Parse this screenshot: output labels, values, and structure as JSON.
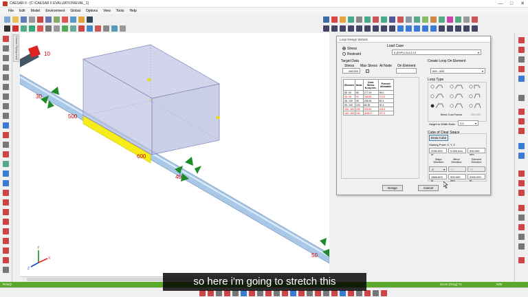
{
  "window": {
    "title": "CAESAR II - [C:\\CAESAR II EVALUATION\\EVAL_1]",
    "minimize": "—",
    "maximize": "□",
    "close": "✕"
  },
  "menu": [
    "File",
    "Edit",
    "Model",
    "Environment",
    "Global",
    "Options",
    "View",
    "Tools",
    "Help"
  ],
  "sidetab_label": "Classic Piping Input",
  "viewport": {
    "node_labels": {
      "n10": "10",
      "n30": "30",
      "n500": "500",
      "n600": "600",
      "n40": "40",
      "n50": "50"
    },
    "axis": {
      "x": "X",
      "y": "Y",
      "z": "Z"
    }
  },
  "dialog": {
    "title": "Loop Design Wizard",
    "mode_stress": "Stress",
    "mode_restraint": "Restraint",
    "load_case_label": "Load Case",
    "load_case_value": "5 (EXP) L5=L3-L4",
    "target_label": "Target Data",
    "col_stress": "Stress",
    "col_max_stress": "Max Stress",
    "col_at_node": "At Node",
    "col_on_element": "On Element",
    "stress_value": "200,000",
    "create_loop_label": "Create Loop On Element",
    "create_loop_value": "500 - 600",
    "loop_type_label": "Loop Type",
    "bend_cost_label": "Bend Cost Factor",
    "bend_cost_value": "200,000",
    "hw_ratio_label": "Height to Width Ratio",
    "hw_ratio_value": "2.0",
    "cube_label": "Cube of Clear Space",
    "draw_cube_button": "Draw Cube",
    "start_point_label": "Starting Point: X, Y, Z",
    "start_x": "2250.000 m",
    "start_y": "0.000 mm",
    "start_z": "900.000 mm",
    "major_dir_label": "Major Direction",
    "minor_dir_label": "Minor Direction",
    "element_dir_label": "Element Direction",
    "major_dir_value": "-Z",
    "minor_dir_value": "+Y",
    "element_dir_value": "+X",
    "major_size": "1866.603 m",
    "minor_size": "900.000 mm",
    "element_size": "2000.000 m",
    "design_button": "Design",
    "cancel_button": "Cancel",
    "table": {
      "headers": [
        "Element",
        "Node",
        "Code Stress N./sq.mm.",
        "Percent Allowable"
      ],
      "rows": [
        [
          "80-  90",
          "80",
          "277.00",
          "99.2"
        ],
        [
          "90-  95",
          "90",
          "755.85",
          "279.5"
        ],
        [
          "95- 100",
          "95",
          "228.96",
          "82.4"
        ],
        [
          "95- 100",
          "100",
          "84.35",
          "30.1"
        ],
        [
          "150- 160",
          "150",
          "299.65",
          "106.3"
        ],
        [
          "160- 180",
          "160",
          "(548.47",
          "207.5"
        ]
      ]
    }
  },
  "status": {
    "left": "Ready",
    "mid": "Zoom (Drag) T1",
    "right": "N/M"
  },
  "caption": "so here i'm going to stretch this"
}
